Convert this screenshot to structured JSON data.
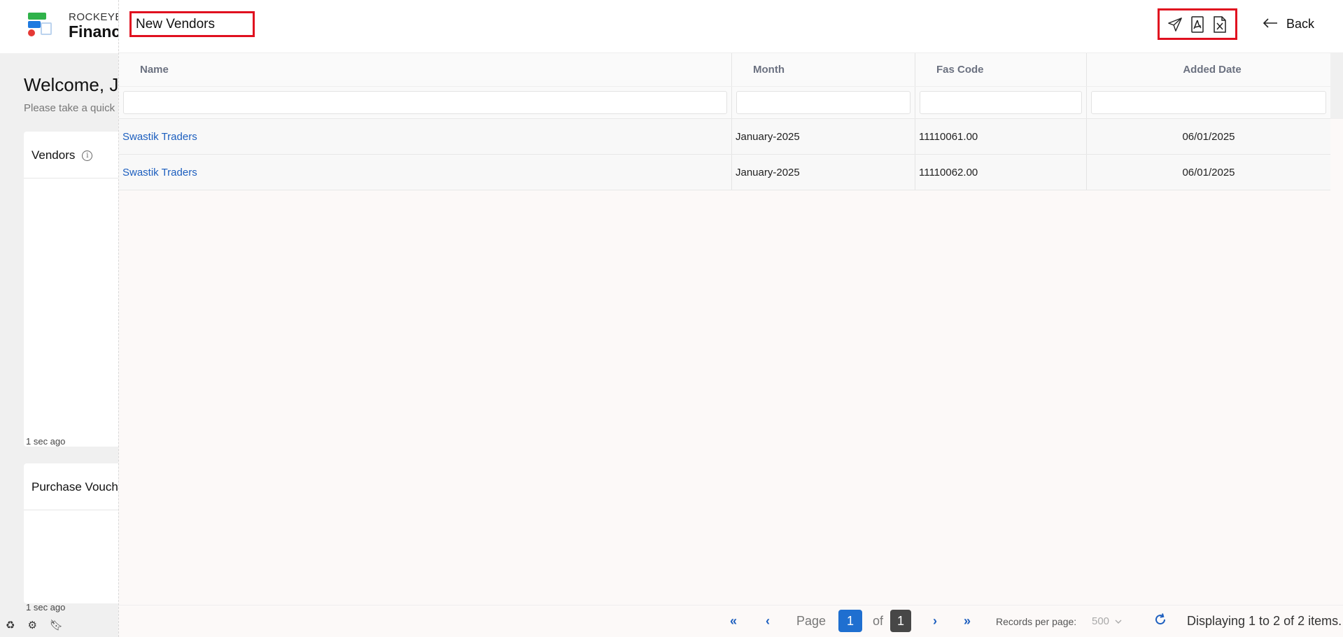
{
  "background": {
    "brand_top": "ROCKEYE",
    "brand_main": "Financ",
    "welcome": "Welcome, Ja",
    "welcome_sub": "Please take a quick",
    "card_vendors_title": "Vendors",
    "card_pv_title": "Purchase Vouch",
    "time_ago_1": "1 sec ago",
    "time_ago_2": "1 sec ago",
    "bottom_icons": [
      "recycle-icon",
      "gears-icon",
      "bookmark-icon"
    ]
  },
  "drawer": {
    "title": "New Vendors",
    "actions": [
      "send-icon",
      "pdf-icon",
      "excel-icon"
    ],
    "back_label": "Back"
  },
  "grid": {
    "columns": [
      "Name",
      "Month",
      "Fas Code",
      "Added Date"
    ],
    "rows": [
      {
        "name": "Swastik Traders",
        "month": "January-2025",
        "fas_code": "11110061.00",
        "added_date": "06/01/2025"
      },
      {
        "name": "Swastik Traders",
        "month": "January-2025",
        "fas_code": "11110062.00",
        "added_date": "06/01/2025"
      }
    ]
  },
  "pagination": {
    "page_label": "Page",
    "current_page": "1",
    "of_label": "of",
    "total_pages": "1",
    "records_per_page_label": "Records per page:",
    "records_per_page": "500",
    "display_info": "Displaying 1 to 2 of 2 items."
  },
  "colors": {
    "accent": "#1f6fd0",
    "highlight_border": "#e0101f",
    "link": "#1d5fbf"
  }
}
